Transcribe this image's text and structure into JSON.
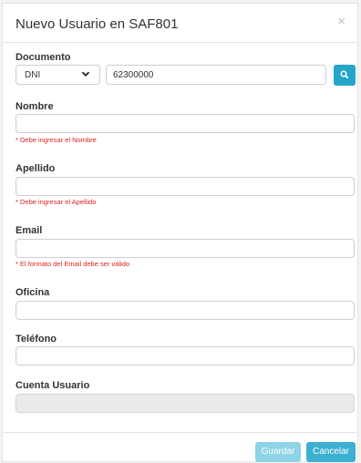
{
  "modal": {
    "title": "Nuevo Usuario en SAF801",
    "close": "×"
  },
  "documento": {
    "label": "Documento",
    "type_selected": "DNI",
    "number_value": "62300000"
  },
  "nombre": {
    "label": "Nombre",
    "value": "",
    "error": "* Debe ingresar el Nombre"
  },
  "apellido": {
    "label": "Apellido",
    "value": "",
    "error": "* Debe ingresar el Apellido"
  },
  "email": {
    "label": "Email",
    "value": "",
    "error": "* El formato del Email debe ser válido"
  },
  "oficina": {
    "label": "Oficina",
    "value": ""
  },
  "telefono": {
    "label": "Teléfono",
    "value": ""
  },
  "cuenta_usuario": {
    "label": "Cuenta Usuario",
    "value": ""
  },
  "footer": {
    "save_label": "Guardar",
    "cancel_label": "Cancelar"
  },
  "colors": {
    "accent": "#3dafd0",
    "error": "#e02020",
    "save_disabled": "#8fd3e6"
  },
  "icons": {
    "search": "search-icon",
    "chevron": "chevron-down-icon",
    "close": "close-icon"
  }
}
